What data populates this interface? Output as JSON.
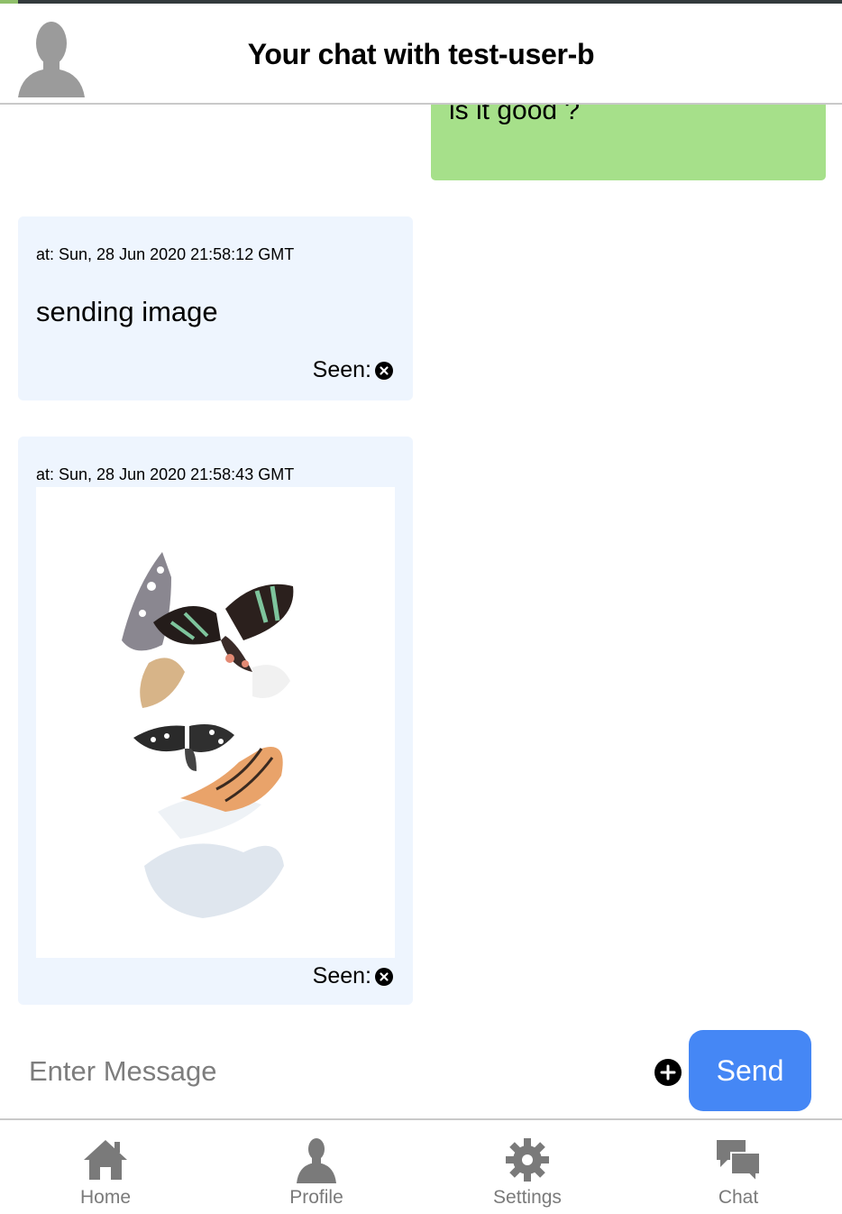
{
  "header": {
    "title": "Your chat with test-user-b",
    "avatar_icon": "user-silhouette-icon"
  },
  "messages": [
    {
      "direction": "outgoing",
      "text": "is it good ?",
      "color": "#a6e08a"
    },
    {
      "direction": "incoming",
      "timestamp": "at: Sun, 28 Jun 2020 21:58:12 GMT",
      "text": "sending image",
      "seen_label": "Seen:",
      "seen_icon": "close-circle-icon",
      "color": "#eef5fe"
    },
    {
      "direction": "incoming",
      "timestamp": "at: Sun, 28 Jun 2020 21:58:43 GMT",
      "image": "butterflies-image",
      "seen_label": "Seen:",
      "seen_icon": "close-circle-icon",
      "color": "#eef5fe"
    }
  ],
  "composer": {
    "placeholder": "Enter Message",
    "attach_icon": "plus-circle-icon",
    "send_label": "Send",
    "send_color": "#4587f5"
  },
  "tabs": [
    {
      "label": "Home",
      "icon": "home-icon"
    },
    {
      "label": "Profile",
      "icon": "profile-icon"
    },
    {
      "label": "Settings",
      "icon": "gear-icon"
    },
    {
      "label": "Chat",
      "icon": "chat-icon"
    }
  ]
}
